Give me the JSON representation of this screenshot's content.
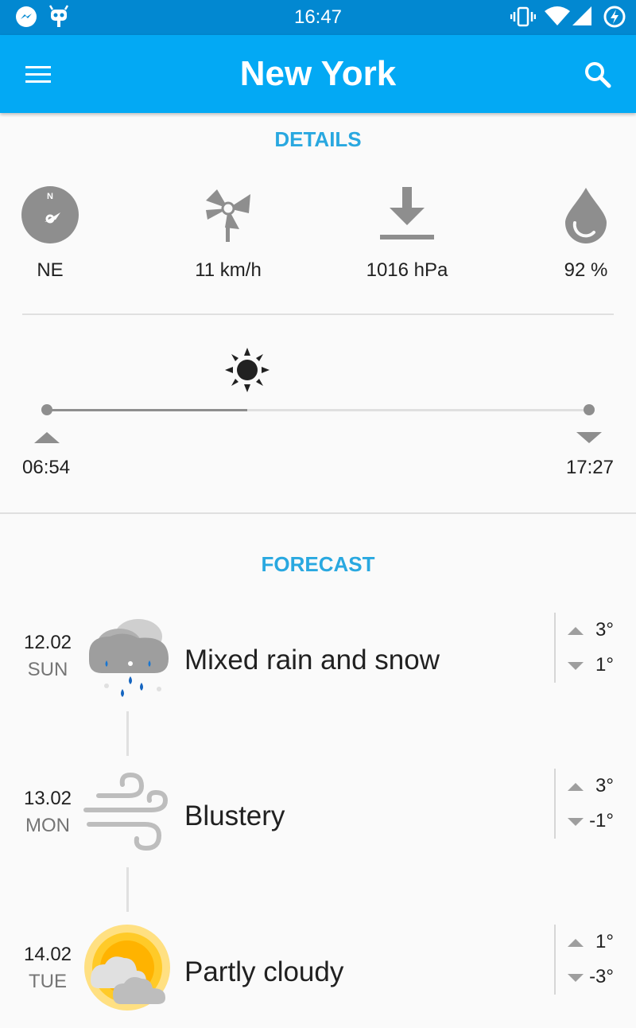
{
  "status_bar": {
    "time": "16:47"
  },
  "app_bar": {
    "title": "New York"
  },
  "details": {
    "section_title": "DETAILS",
    "wind_direction": "NE",
    "wind_speed": "11 km/h",
    "pressure": "1016 hPa",
    "humidity": "92 %"
  },
  "sun": {
    "sunrise": "06:54",
    "sunset": "17:27",
    "day_progress": 0.37
  },
  "forecast": {
    "section_title": "FORECAST",
    "days": [
      {
        "date": "12.02",
        "day": "SUN",
        "condition": "Mixed rain and snow",
        "high": "3°",
        "low": "1°",
        "icon": "rain-snow-icon"
      },
      {
        "date": "13.02",
        "day": "MON",
        "condition": "Blustery",
        "high": "3°",
        "low": "-1°",
        "icon": "wind-icon"
      },
      {
        "date": "14.02",
        "day": "TUE",
        "condition": "Partly cloudy",
        "high": "1°",
        "low": "-3°",
        "icon": "partly-cloudy-icon"
      }
    ]
  },
  "colors": {
    "status_bar": "#0288d1",
    "app_bar": "#03a9f4",
    "accent": "#29a8e0",
    "icon_gray": "#8e8e8e"
  }
}
